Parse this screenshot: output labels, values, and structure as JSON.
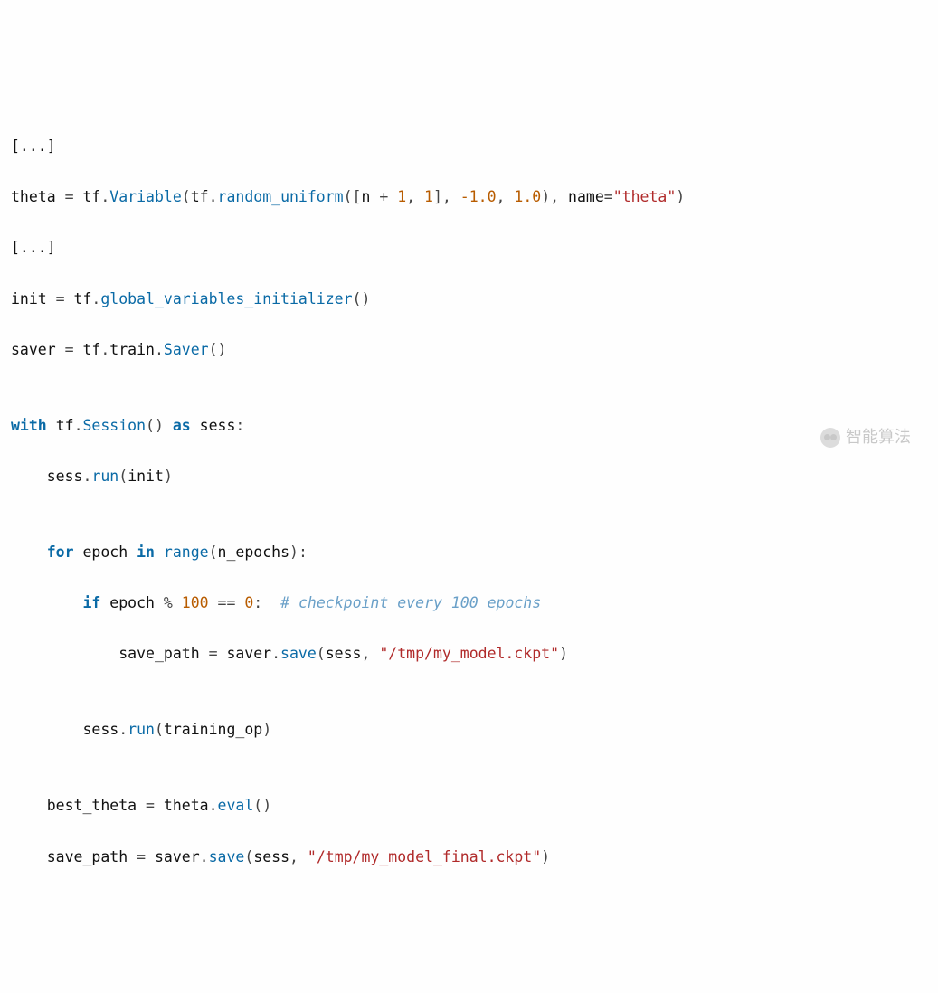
{
  "code": {
    "l1": {
      "ellipsis": "[...]"
    },
    "l2": {
      "a": "theta ",
      "eq": "= ",
      "b": "tf",
      "dot1": ".",
      "c": "Variable",
      "op": "(",
      "d": "tf",
      "dot2": ".",
      "e": "random_uniform",
      "op2": "([",
      "f": "n ",
      "plus": "+ ",
      "one": "1",
      "comma1": ", ",
      "one2": "1",
      "close1": "], ",
      "neg": "-1.0",
      "comma2": ", ",
      "pos": "1.0",
      "close2": "), ",
      "name_kw": "name",
      "eq2": "=",
      "str": "\"theta\"",
      "close3": ")"
    },
    "l3": {
      "ellipsis": "[...]"
    },
    "l4": {
      "a": "init ",
      "eq": "= ",
      "b": "tf",
      "dot": ".",
      "c": "global_variables_initializer",
      "paren": "()"
    },
    "l5": {
      "a": "saver ",
      "eq": "= ",
      "b": "tf",
      "d1": ".",
      "c": "train",
      "d2": ".",
      "d": "Saver",
      "paren": "()"
    },
    "l6": {
      "blank": ""
    },
    "l7": {
      "with": "with",
      "sp": " ",
      "a": "tf",
      "dot": ".",
      "b": "Session",
      "paren": "() ",
      "as": "as",
      "sp2": " ",
      "c": "sess",
      "colon": ":"
    },
    "l8": {
      "indent": "    ",
      "a": "sess",
      "dot": ".",
      "b": "run",
      "op": "(",
      "c": "init",
      "cp": ")"
    },
    "l9": {
      "blank": ""
    },
    "l10": {
      "indent": "    ",
      "for": "for",
      "sp": " ",
      "a": "epoch ",
      "in": "in",
      "sp2": " ",
      "b": "range",
      "op": "(",
      "c": "n_epochs",
      "cp": "):"
    },
    "l11": {
      "indent": "        ",
      "if": "if",
      "sp": " ",
      "a": "epoch ",
      "pct": "% ",
      "h": "100",
      "sp2": " ",
      "eq": "== ",
      "z": "0",
      "colon": ":  ",
      "cmt": "# checkpoint every 100 epochs"
    },
    "l12": {
      "indent": "            ",
      "a": "save_path ",
      "eq": "= ",
      "b": "saver",
      "dot": ".",
      "c": "save",
      "op": "(",
      "d": "sess",
      "cm": ", ",
      "str": "\"/tmp/my_model.ckpt\"",
      "cp": ")"
    },
    "l13": {
      "blank": ""
    },
    "l14": {
      "indent": "        ",
      "a": "sess",
      "dot": ".",
      "b": "run",
      "op": "(",
      "c": "training_op",
      "cp": ")"
    },
    "l15": {
      "blank": ""
    },
    "l16": {
      "indent": "    ",
      "a": "best_theta ",
      "eq": "= ",
      "b": "theta",
      "dot": ".",
      "c": "eval",
      "paren": "()"
    },
    "l17": {
      "indent": "    ",
      "a": "save_path ",
      "eq": "= ",
      "b": "saver",
      "dot": ".",
      "c": "save",
      "op": "(",
      "d": "sess",
      "cm": ", ",
      "str": "\"/tmp/my_model_final.ckpt\"",
      "cp": ")"
    }
  },
  "watermark": {
    "text": "智能算法"
  }
}
